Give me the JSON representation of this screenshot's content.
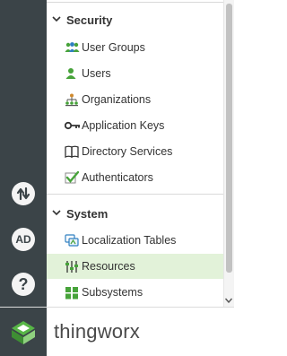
{
  "sections": [
    {
      "label": "Security",
      "items": [
        {
          "label": "User Groups",
          "icon": "user-groups-icon"
        },
        {
          "label": "Users",
          "icon": "users-icon"
        },
        {
          "label": "Organizations",
          "icon": "organizations-icon"
        },
        {
          "label": "Application Keys",
          "icon": "key-icon"
        },
        {
          "label": "Directory Services",
          "icon": "book-icon"
        },
        {
          "label": "Authenticators",
          "icon": "checkmark-icon"
        }
      ]
    },
    {
      "label": "System",
      "items": [
        {
          "label": "Localization Tables",
          "icon": "localization-icon"
        },
        {
          "label": "Resources",
          "icon": "sliders-icon",
          "selected": true
        },
        {
          "label": "Subsystems",
          "icon": "subsystems-icon"
        }
      ]
    }
  ],
  "rail": {
    "ad_label": "AD",
    "help_label": "?"
  },
  "brand": {
    "name": "thingworx"
  },
  "colors": {
    "rail": "#3b4448",
    "selected_bg": "#e2f2d9",
    "accent_green": "#47a33a"
  }
}
